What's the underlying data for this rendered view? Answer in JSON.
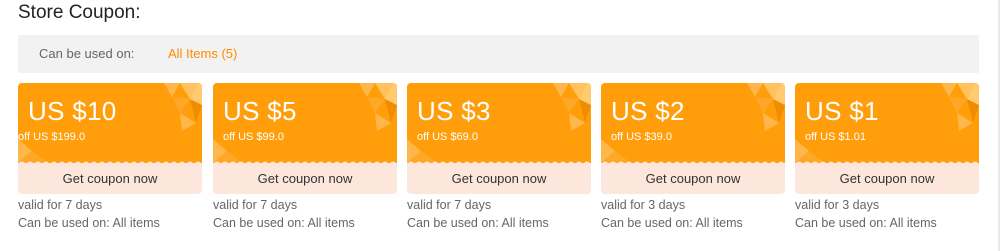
{
  "section_title": "Store Coupon:",
  "filter": {
    "label": "Can be used on:",
    "value": "All Items (5)"
  },
  "colors": {
    "accent": "#ff8a00",
    "coupon_bg": "#ff9e0a",
    "button_bg": "#fde6dc"
  },
  "coupons": [
    {
      "amount": "US $10",
      "min_order": "off US $199.0",
      "button": "Get coupon now",
      "validity": "valid for 7 days",
      "scope": "Can be used on: All items"
    },
    {
      "amount": "US $5",
      "min_order": "off US $99.0",
      "button": "Get coupon now",
      "validity": "valid for 7 days",
      "scope": "Can be used on: All items"
    },
    {
      "amount": "US $3",
      "min_order": "off US $69.0",
      "button": "Get coupon now",
      "validity": "valid for 7 days",
      "scope": "Can be used on: All items"
    },
    {
      "amount": "US $2",
      "min_order": "off US $39.0",
      "button": "Get coupon now",
      "validity": "valid for 3 days",
      "scope": "Can be used on: All items"
    },
    {
      "amount": "US $1",
      "min_order": "off US $1.01",
      "button": "Get coupon now",
      "validity": "valid for 3 days",
      "scope": "Can be used on: All items"
    }
  ]
}
